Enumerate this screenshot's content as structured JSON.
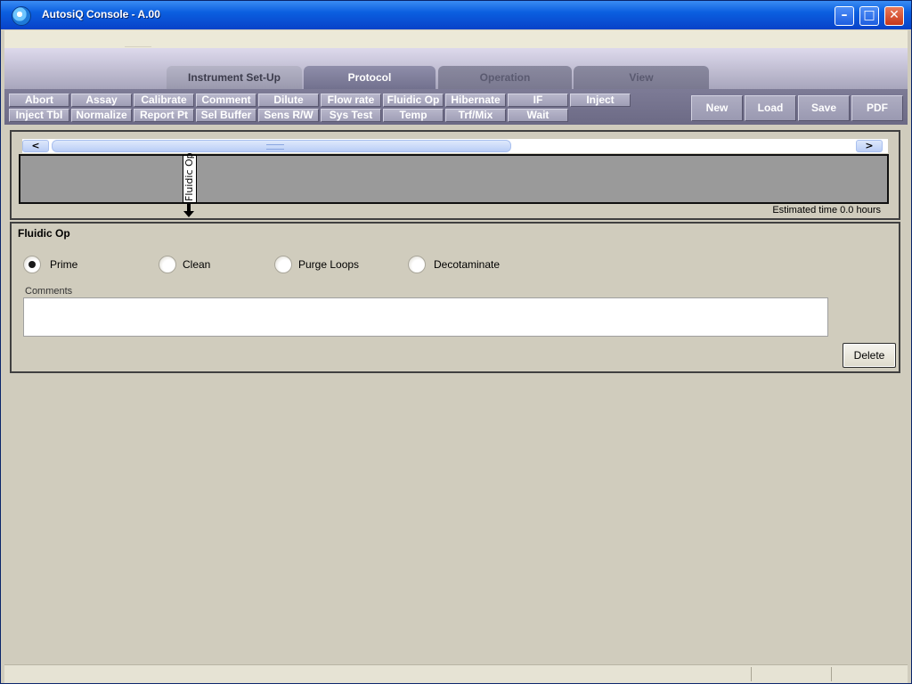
{
  "window": {
    "title": "AutosiQ Console - A.00"
  },
  "tabs": [
    {
      "label": "Instrument Set-Up"
    },
    {
      "label": "Protocol"
    },
    {
      "label": "Operation"
    },
    {
      "label": "View"
    }
  ],
  "commands": {
    "row1": [
      "Abort",
      "Assay",
      "Calibrate",
      "Comment",
      "Dilute",
      "Flow rate",
      "Fluidic Op",
      "Hibernate",
      "IF",
      "Inject"
    ],
    "row2": [
      "Inject Tbl",
      "Normalize",
      "Report Pt",
      "Sel Buffer",
      "Sens R/W",
      "Sys Test",
      "Temp",
      "Trf/Mix",
      "Wait"
    ]
  },
  "file_buttons": {
    "new": "New",
    "load": "Load",
    "save": "Save",
    "pdf": "PDF"
  },
  "timeline": {
    "scroll_left": "<",
    "scroll_right": ">",
    "step_label": "Fluidic Op",
    "estimated_time": "Estimated time  0.0 hours"
  },
  "detail": {
    "title": "Fluidic Op",
    "options": [
      {
        "label": "Prime",
        "selected": true
      },
      {
        "label": "Clean",
        "selected": false
      },
      {
        "label": "Purge Loops",
        "selected": false
      },
      {
        "label": "Decotaminate",
        "selected": false
      }
    ],
    "comments_label": "Comments",
    "comments_value": "",
    "delete_label": "Delete"
  },
  "colors": {
    "accent": "#72718e",
    "titlebar": "#0b5fe0",
    "panel": "#d0ccbd"
  },
  "icons": {
    "app": "app-logo-icon",
    "minimize": "minimize-icon",
    "maximize": "maximize-icon",
    "close": "close-icon",
    "arrow": "down-arrow-icon"
  }
}
